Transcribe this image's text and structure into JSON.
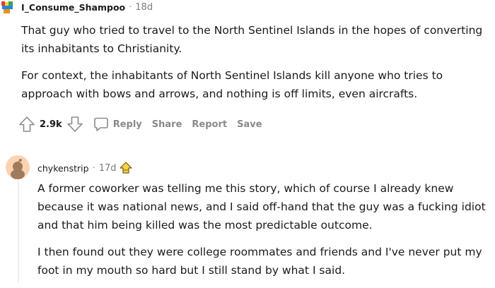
{
  "comments": [
    {
      "username": "I_Consume_Shampoo",
      "separator": "·",
      "time": "18d",
      "paragraphs": [
        "That guy who tried to travel to the North Sentinel Islands in the hopes of converting",
        "its inhabitants to Christianity.",
        "For context, the inhabitants of North Sentinel Islands kill anyone who tries to",
        "approach with bows and arrows, and nothing is off limits, even aircrafts."
      ],
      "score": "2.9k",
      "actions": {
        "reply": "Reply",
        "share": "Share",
        "report": "Report",
        "save": "Save"
      }
    },
    {
      "username": "chykenstrip",
      "separator": "·",
      "time": "17d",
      "paragraphs": [
        "A former coworker was telling me this story, which of course I already knew",
        "because it was national news, and I said off-hand that the guy was a fucking idiot",
        "and that him being killed was the most predictable outcome.",
        "I then found out they were college roommates and friends and I've never put my",
        "foot in my mouth so hard but I still stand by what I said."
      ]
    }
  ],
  "icons": {
    "upvote": "arrow-up-icon",
    "downvote": "arrow-down-icon",
    "reply": "speech-bubble-icon",
    "award": "award-icon"
  },
  "colors": {
    "text": "#1a1a1b",
    "meta": "#878a8c",
    "threadLine": "#edeff1",
    "avatarBg": "#fcd3b2"
  }
}
